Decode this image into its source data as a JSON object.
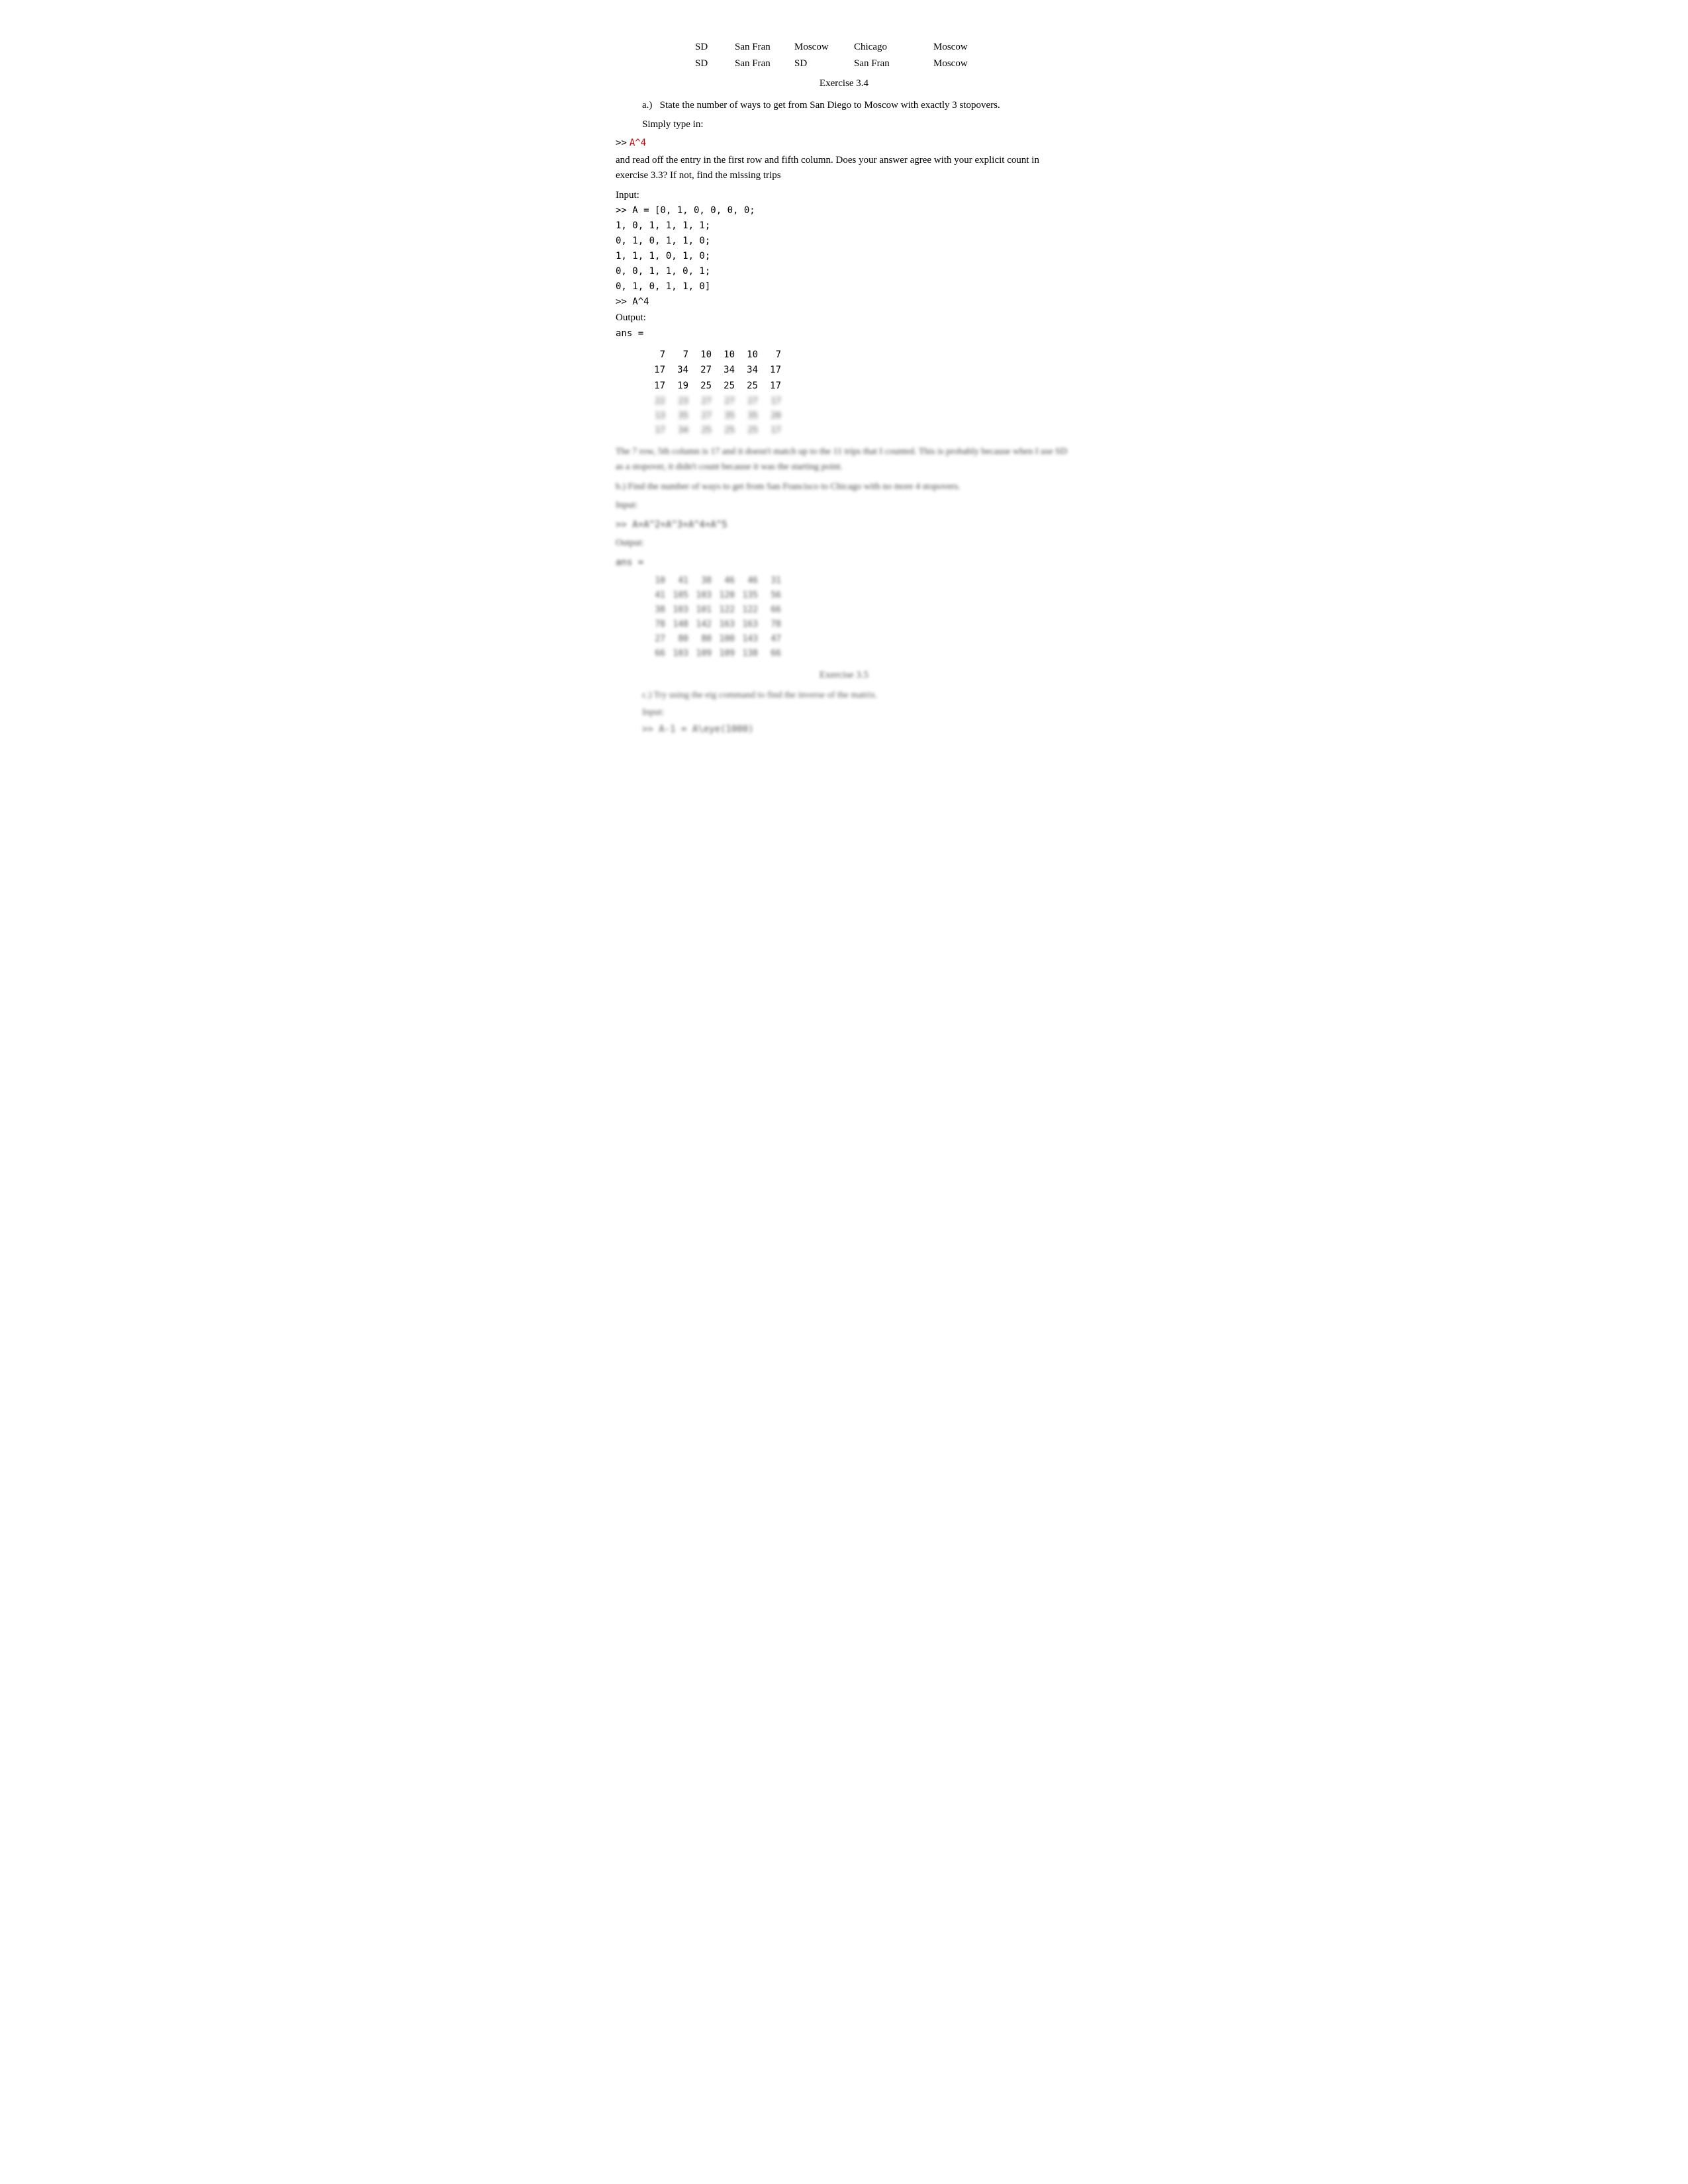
{
  "routes": {
    "row1": {
      "col1": "SD",
      "col2": "San Fran",
      "col3": "Moscow",
      "col4": "Chicago",
      "col5": "Moscow"
    },
    "row2": {
      "col1": "SD",
      "col2": "San Fran",
      "col3": "SD",
      "col4": "San Fran",
      "col5": "Moscow"
    }
  },
  "exercise_header": "Exercise 3.4",
  "part_a": {
    "label": "a.)",
    "question": "State the number of ways to get from San Diego to Moscow with exactly 3 stopovers.",
    "instruction": "Simply type in:",
    "prompt": ">>",
    "command": "A^4"
  },
  "paragraph1": "and read off the entry in the first row and fifth column.  Does your answer agree with your explicit count in exercise 3.3?  If not, find the missing trips",
  "input_label": "Input:",
  "code_lines": [
    ">> A = [0, 1, 0, 0, 0, 0;",
    "1, 0, 1, 1, 1, 1;",
    "0, 1, 0, 1, 1, 0;",
    "1, 1, 1, 0, 1, 0;",
    "0, 0, 1, 1, 0, 1;",
    "0, 1, 0, 1, 1, 0]",
    ">> A^4"
  ],
  "output_label": "Output:",
  "ans_label": "ans =",
  "matrix_clear": [
    [
      "7",
      "7",
      "10",
      "10",
      "10",
      "7"
    ],
    [
      "17",
      "34",
      "27",
      "34",
      "34",
      "17"
    ],
    [
      "17",
      "19",
      "25",
      "25",
      "25",
      "17"
    ]
  ],
  "matrix_blurred": [
    [
      "??",
      "??",
      "??",
      "??",
      "??",
      "??"
    ],
    [
      "??",
      "??",
      "??",
      "??",
      "??",
      "??"
    ],
    [
      "??",
      "??",
      "??",
      "??",
      "??",
      "??"
    ]
  ],
  "blurred_explanation": "The 7 row, 5th column is 17 and it doesn't match up to the 11 trips that I counted. This is probably because when I use SD as a stopover, it didn't count because it was the starting point.",
  "part_b_label": "b.)  Find the number of ways to get from San Francisco to Chicago with no more 4 stopovers.",
  "part_b_input": "Input:",
  "part_b_command": ">> A+A^2+A^3+A^4+A^5",
  "part_b_output": "Output:",
  "part_b_ans": "ans =",
  "matrix_b": [
    [
      "10",
      "41",
      "38",
      "46",
      "46",
      "31"
    ],
    [
      "41",
      "105",
      "103",
      "120",
      "135",
      "56"
    ],
    [
      "38",
      "103",
      "101",
      "122",
      "122",
      "66"
    ],
    [
      "78",
      "148",
      "142",
      "163",
      "163",
      "78"
    ],
    [
      "27",
      "80",
      "80",
      "100",
      "143",
      "47"
    ],
    [
      "66",
      "103",
      "109",
      "109",
      "138",
      "66"
    ]
  ],
  "exercise_35": "Exercise 3.5",
  "part_c_label": "c.)  Try using the eig command to find the inverse of the matrix.",
  "part_c_input": "Input:",
  "part_c_command": ">> A-1 = A\\eye(1000)"
}
